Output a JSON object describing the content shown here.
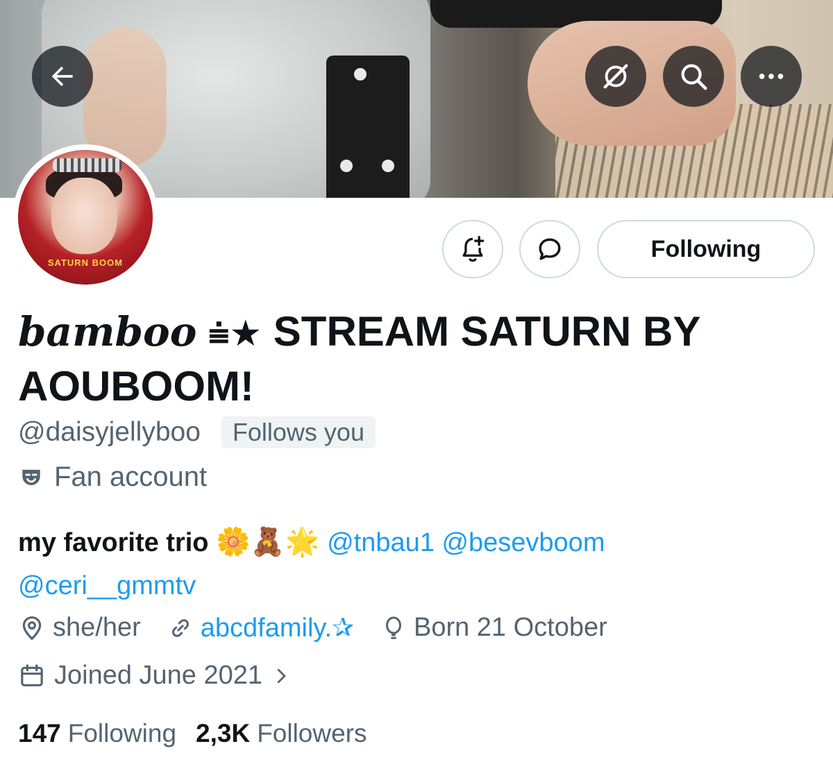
{
  "header": {
    "back_icon": "arrow-left-icon",
    "buttons": [
      "grok-icon",
      "search-icon",
      "more-icon"
    ]
  },
  "avatar": {
    "overlay_text": "SATURN BOOM"
  },
  "actions": {
    "notify_icon": "bell-plus-icon",
    "message_icon": "message-icon",
    "following_label": "Following"
  },
  "profile": {
    "display_name_script": "bamboo",
    "display_name_symbol": "⩧★",
    "display_name_rest": " STREAM SATURN BY AOUBOOM!",
    "handle": "@daisyjellyboo",
    "follows_you": "Follows you",
    "category": "Fan account",
    "bio_text": "my favorite trio ",
    "bio_emojis": "🌼🧸🌟",
    "bio_mentions": [
      "@tnbau1",
      "@besevboom",
      "@ceri__gmmtv"
    ],
    "pronouns": "she/her",
    "website": "abcdfamily.✰",
    "birthday": "Born 21 October",
    "joined": "Joined June 2021",
    "following_count": "147",
    "following_label": "Following",
    "followers_count": "2,3K",
    "followers_label": "Followers"
  },
  "colors": {
    "accent": "#1d9bf0",
    "secondary_text": "#536471",
    "primary_text": "#0f1419",
    "border": "#cfd9de"
  }
}
